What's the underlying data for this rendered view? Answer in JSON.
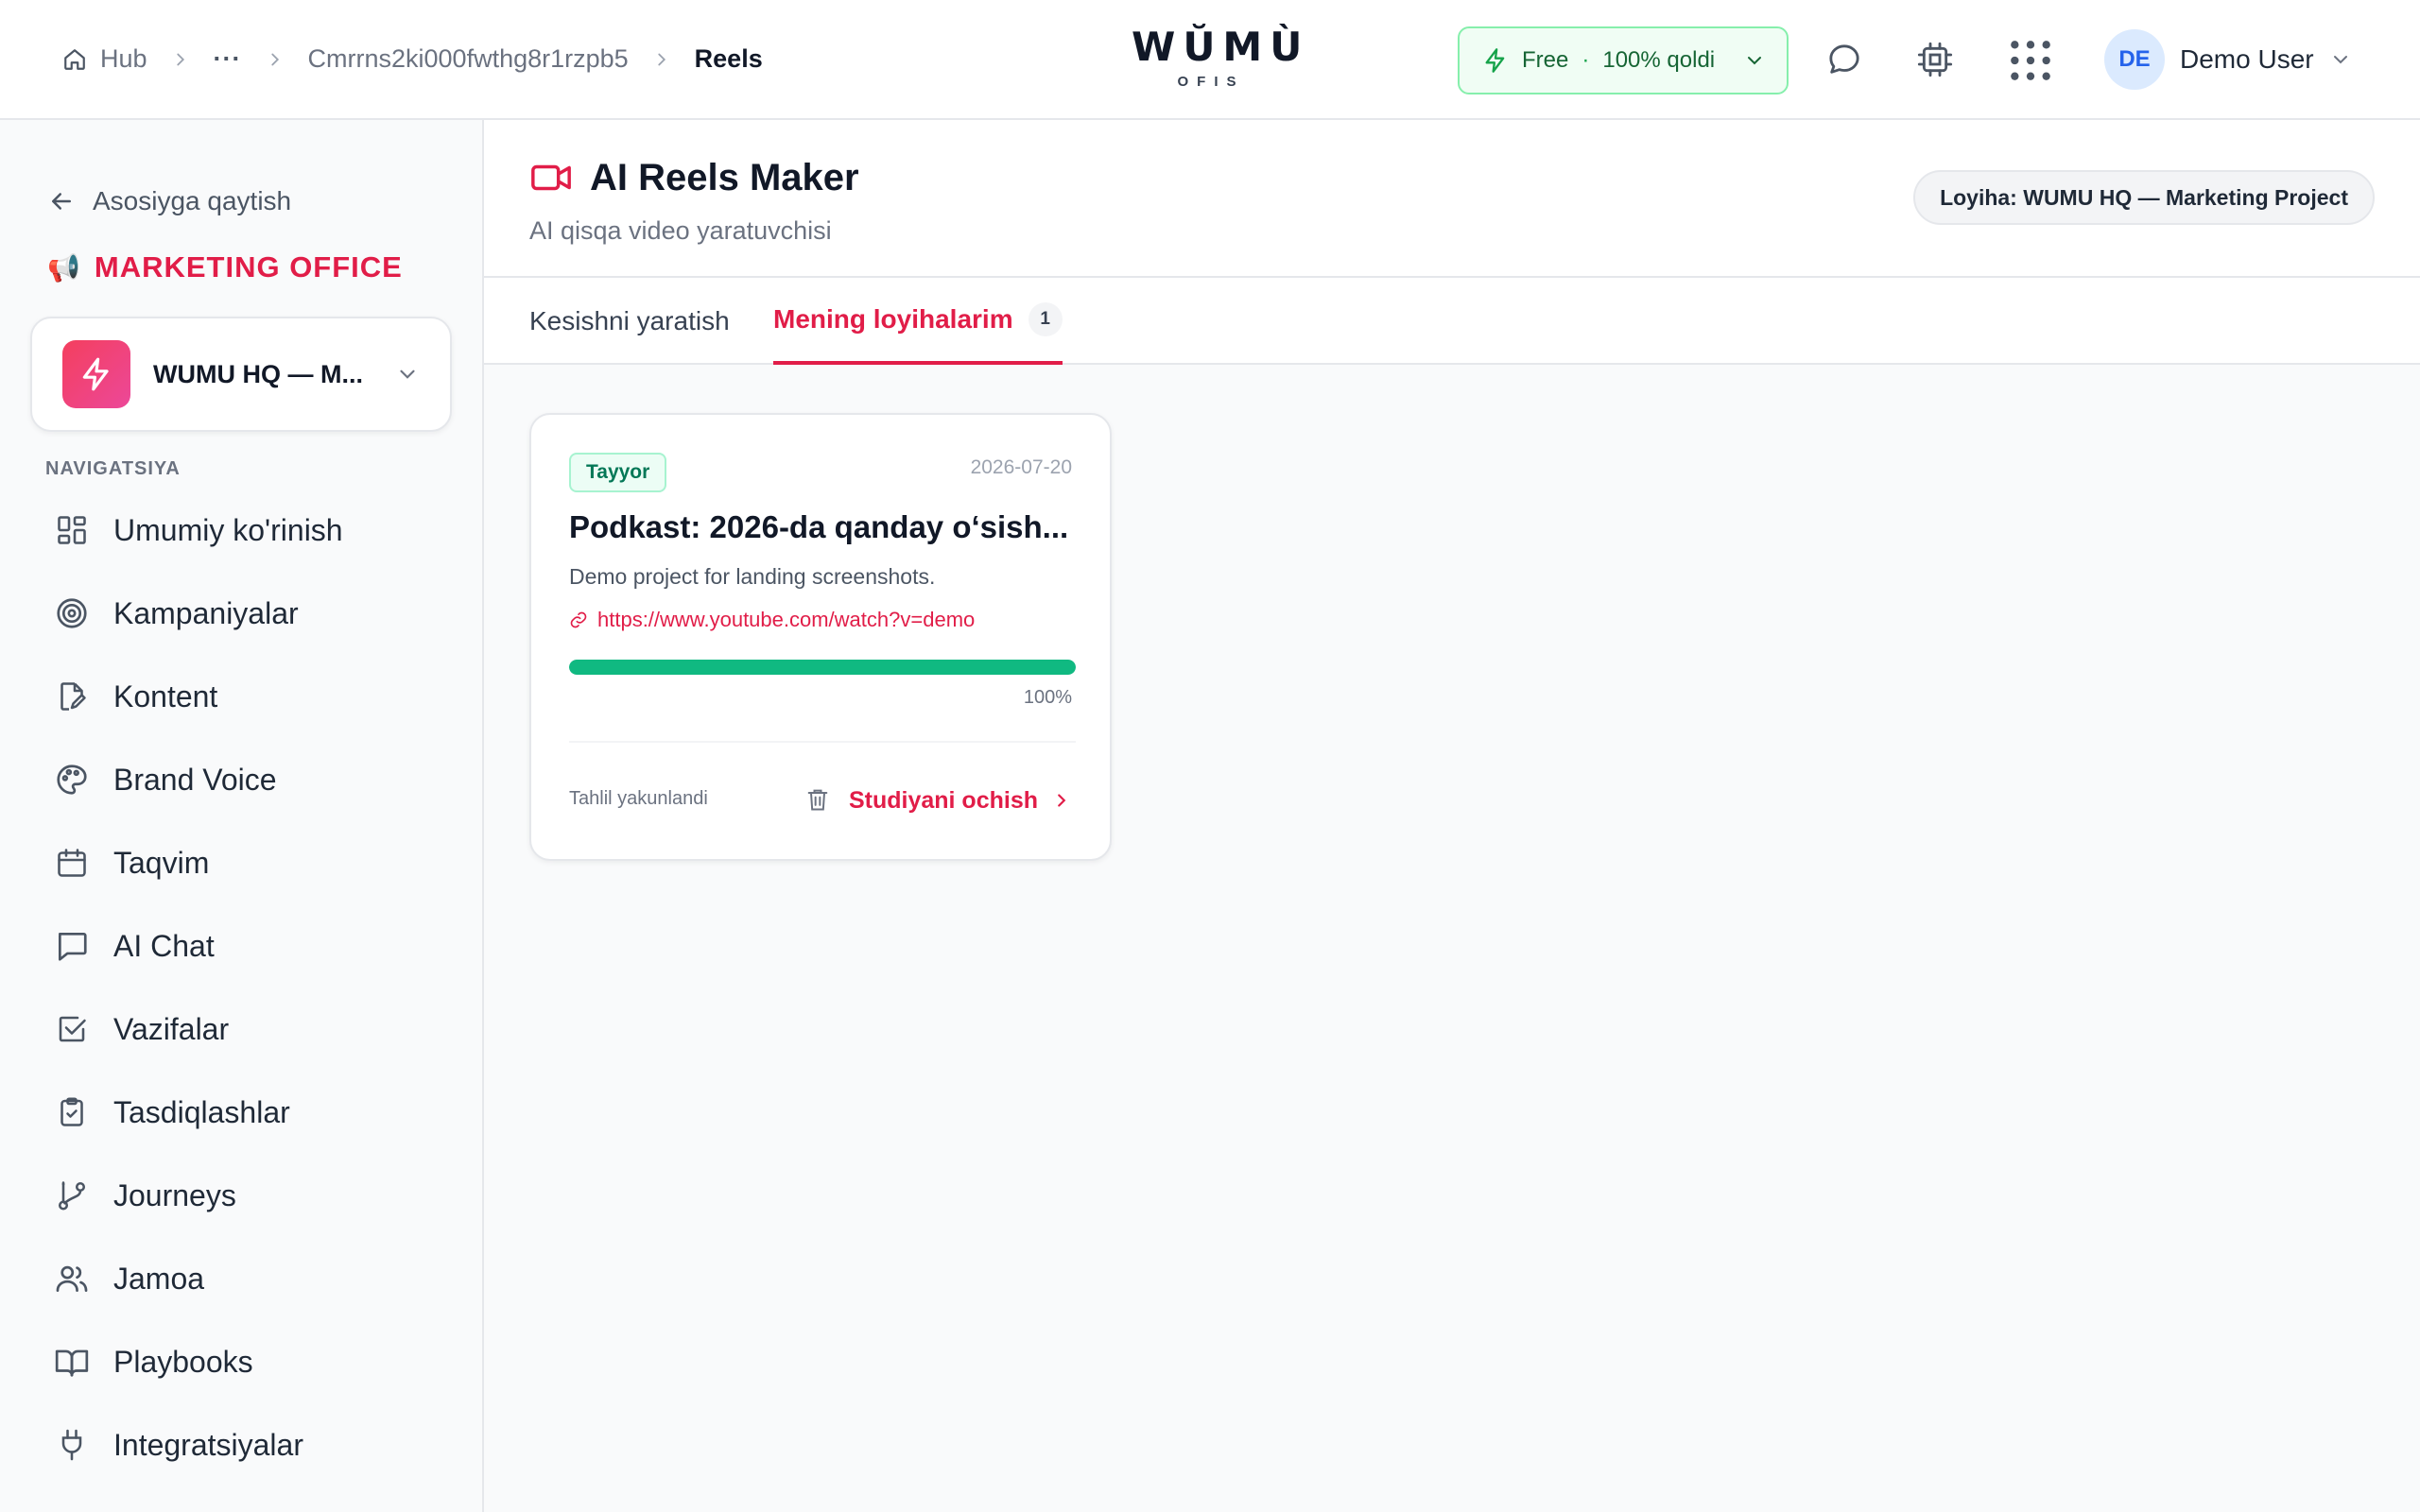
{
  "breadcrumb": {
    "home": "Hub",
    "ellipsis": "···",
    "project_id": "Cmrrns2ki000fwthg8r1rzpb5",
    "current": "Reels"
  },
  "logo": {
    "main": "WŬMÙ",
    "sub": "OFIS"
  },
  "plan": {
    "name": "Free",
    "separator": "·",
    "remaining": "100% qoldi"
  },
  "user": {
    "initials": "DE",
    "name": "Demo User"
  },
  "sidebar": {
    "back_label": "Asosiyga qaytish",
    "office_emoji": "📢",
    "office_title": "MARKETING OFFICE",
    "project_name": "WUMU HQ — M...",
    "nav_heading": "NAVIGATSIYA",
    "items": [
      {
        "label": "Umumiy ko'rinish",
        "icon": "dashboard-icon"
      },
      {
        "label": "Kampaniyalar",
        "icon": "target-icon"
      },
      {
        "label": "Kontent",
        "icon": "file-edit-icon"
      },
      {
        "label": "Brand Voice",
        "icon": "palette-icon"
      },
      {
        "label": "Taqvim",
        "icon": "calendar-icon"
      },
      {
        "label": "AI Chat",
        "icon": "chat-icon"
      },
      {
        "label": "Vazifalar",
        "icon": "checkbox-icon"
      },
      {
        "label": "Tasdiqlashlar",
        "icon": "clipboard-check-icon"
      },
      {
        "label": "Journeys",
        "icon": "git-branch-icon"
      },
      {
        "label": "Jamoa",
        "icon": "users-icon"
      },
      {
        "label": "Playbooks",
        "icon": "book-open-icon"
      },
      {
        "label": "Integratsiyalar",
        "icon": "plug-icon"
      }
    ]
  },
  "page": {
    "title": "AI Reels Maker",
    "subtitle": "AI qisqa video yaratuvchisi",
    "project_badge": "Loyiha: WUMU HQ — Marketing Project"
  },
  "tabs": [
    {
      "label": "Kesishni yaratish"
    },
    {
      "label": "Mening loyihalarim",
      "count": "1"
    }
  ],
  "card": {
    "status": "Tayyor",
    "date": "2026-07-20",
    "title": "Podkast: 2026-da qanday oʻsish...",
    "description": "Demo project for landing screenshots.",
    "link": "https://www.youtube.com/watch?v=demo",
    "progress": 1.0,
    "progress_label": "100%",
    "footer_status": "Tahlil yakunlandi",
    "open_label": "Studiyani ochish"
  },
  "colors": {
    "accent": "#e11d48",
    "success": "#10b981",
    "plan_bg": "#f0fdf4",
    "plan_border": "#86efac"
  }
}
